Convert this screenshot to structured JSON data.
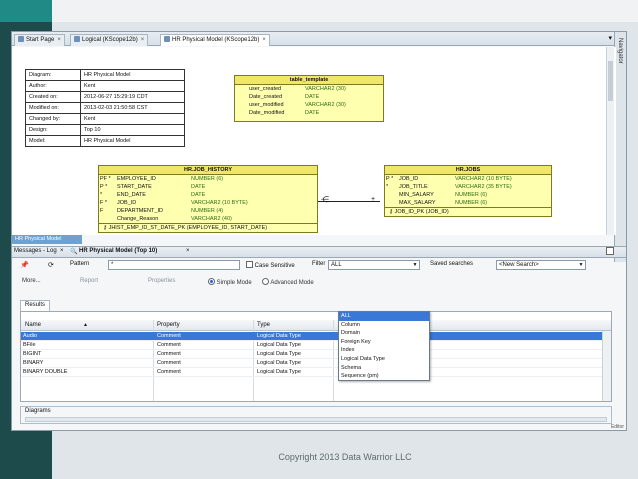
{
  "tabs": [
    {
      "label": "Start Page",
      "active": false
    },
    {
      "label": "Logical (KScope12b)",
      "active": false
    },
    {
      "label": "HR Physical Model (KScope12b)",
      "active": true
    }
  ],
  "navigator_label": "Navigator",
  "info_table": [
    {
      "key": "Diagram:",
      "value": "HR Physical Model"
    },
    {
      "key": "Author:",
      "value": "Kent"
    },
    {
      "key": "Created on:",
      "value": "2012-06-27 15:29:19 CDT"
    },
    {
      "key": "Modified on:",
      "value": "2013-02-03 21:50:58 CST"
    },
    {
      "key": "Changed by:",
      "value": "Kent"
    },
    {
      "key": "Design:",
      "value": "Top 10"
    },
    {
      "key": "Model:",
      "value": "HR Physical Model"
    }
  ],
  "entities": {
    "table_template": {
      "title": "table_template",
      "rows": [
        {
          "mark": "",
          "name": "user_created",
          "type": "VARCHAR2 (30)"
        },
        {
          "mark": "",
          "name": "Date_created",
          "type": "DATE"
        },
        {
          "mark": "",
          "name": "user_modified",
          "type": "VARCHAR2 (30)"
        },
        {
          "mark": "",
          "name": "Date_modified",
          "type": "DATE"
        }
      ]
    },
    "job_history": {
      "title": "HR.JOB_HISTORY",
      "rows": [
        {
          "mark": "PF *",
          "name": "EMPLOYEE_ID",
          "type": "NUMBER (6)"
        },
        {
          "mark": "P  *",
          "name": "START_DATE",
          "type": "DATE"
        },
        {
          "mark": "   *",
          "name": "END_DATE",
          "type": "DATE"
        },
        {
          "mark": "F  *",
          "name": "JOB_ID",
          "type": "VARCHAR2 (10 BYTE)"
        },
        {
          "mark": "F",
          "name": "DEPARTMENT_ID",
          "type": "NUMBER (4)"
        },
        {
          "mark": "",
          "name": "Change_Reason",
          "type": "VARCHAR2 (40)"
        }
      ],
      "index": "JHIST_EMP_ID_ST_DATE_PK (EMPLOYEE_ID, START_DATE)"
    },
    "jobs": {
      "title": "HR.JOBS",
      "rows": [
        {
          "mark": "P  *",
          "name": "JOB_ID",
          "type": "VARCHAR2 (10 BYTE)"
        },
        {
          "mark": "   *",
          "name": "JOB_TITLE",
          "type": "VARCHAR2 (35 BYTE)"
        },
        {
          "mark": "",
          "name": "MIN_SALARY",
          "type": "NUMBER (6)"
        },
        {
          "mark": "",
          "name": "MAX_SALARY",
          "type": "NUMBER (6)"
        }
      ],
      "index": "JOB_ID_PK (JOB_ID)"
    }
  },
  "diagram_tab_label": "HR Physical Model",
  "messages_bar": {
    "log_label": "Messages - Log",
    "search_tab_label": "HR Physical Model (Top 10)"
  },
  "search": {
    "pattern_label": "Pattern",
    "pattern_value": "*",
    "case_sensitive_label": "Case Sensitive",
    "filter_label": "Filter",
    "filter_value": "ALL",
    "saved_searches_label": "Saved searches",
    "saved_searches_value": "<New Search>"
  },
  "toolbar2": {
    "more_label": "More...",
    "report_label": "Report",
    "properties_label": "Properties",
    "simple_mode_label": "Simple Mode",
    "advanced_mode_label": "Advanced Mode"
  },
  "results_tab_label": "Results",
  "grid": {
    "columns": [
      "Name",
      "Property",
      "Type"
    ],
    "rows": [
      {
        "name": "Audio",
        "property": "Comment",
        "type": "Logical Data Type"
      },
      {
        "name": "BFile",
        "property": "Comment",
        "type": "Logical Data Type"
      },
      {
        "name": "BIGINT",
        "property": "Comment",
        "type": "Logical Data Type"
      },
      {
        "name": "BINARY",
        "property": "Comment",
        "type": "Logical Data Type"
      },
      {
        "name": "BINARY DOUBLE",
        "property": "Comment",
        "type": "Logical Data Type"
      }
    ],
    "selected_index": 0
  },
  "filter_options": [
    "ALL",
    "Column",
    "Domain",
    "Foreign Key",
    "Index",
    "Logical Data Type",
    "Schema",
    "Sequence (pm)"
  ],
  "diagrams_label": "Diagrams",
  "editor_label": "Editor",
  "copyright": "Copyright 2013 Data Warrior LLC"
}
